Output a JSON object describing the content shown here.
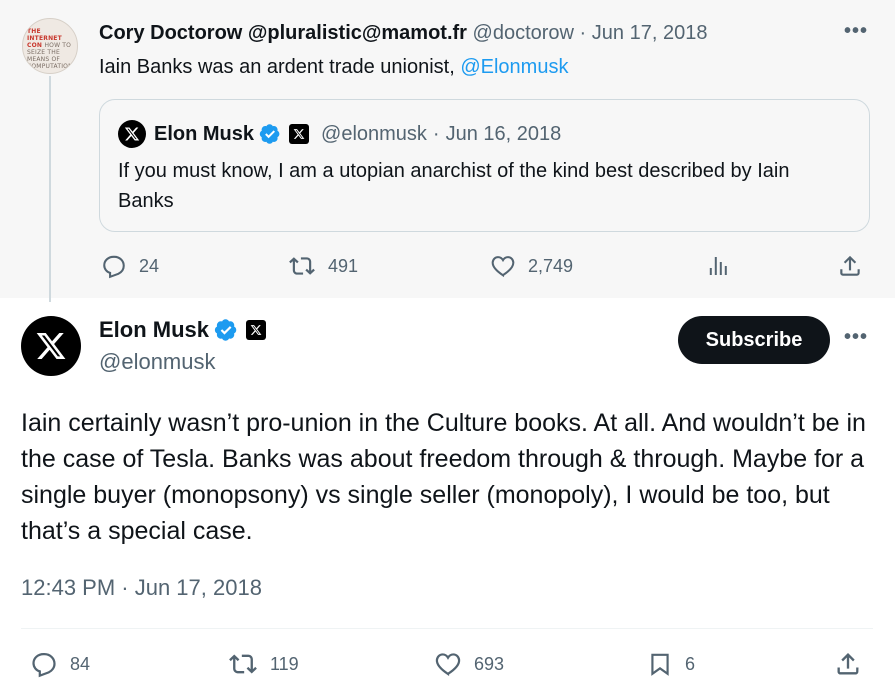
{
  "parent_tweet": {
    "display_name": "Cory Doctorow @pluralistic@mamot.fr",
    "handle": "@doctorow",
    "separator": "·",
    "date": "Jun 17, 2018",
    "text_prefix": "Iain Banks was an ardent trade unionist, ",
    "mention": "@Elonmusk",
    "avatar_text": [
      "THE",
      "INTERNET",
      "CON",
      "HOW TO",
      "SEIZE THE",
      "MEANS OF",
      "COMPUTATION"
    ],
    "quoted": {
      "display_name": "Elon Musk",
      "handle": "@elonmusk",
      "separator": "·",
      "date": "Jun 16, 2018",
      "text": "If you must know, I am a utopian anarchist of the kind best described by Iain Banks"
    },
    "stats": {
      "replies": "24",
      "reposts": "491",
      "likes": "2,749"
    }
  },
  "main_tweet": {
    "display_name": "Elon Musk",
    "handle": "@elonmusk",
    "subscribe_label": "Subscribe",
    "text": "Iain certainly wasn’t pro-union in the Culture books. At all. And wouldn’t be in the case of Tesla. Banks was about freedom through & through. Maybe for a single buyer (monopsony) vs single seller (monopoly), I would be too, but that’s a special case.",
    "timestamp": "12:43 PM · Jun 17, 2018",
    "stats": {
      "replies": "84",
      "reposts": "119",
      "likes": "693",
      "bookmarks": "6"
    }
  },
  "more_label": "•••",
  "colors": {
    "accent": "#1d9bf0",
    "muted": "#536471",
    "verified": "#1d9bf0"
  },
  "icons": [
    "reply-icon",
    "repost-icon",
    "like-icon",
    "views-icon",
    "share-icon",
    "bookmark-icon",
    "verified-badge-icon",
    "x-logo-icon",
    "more-icon"
  ]
}
